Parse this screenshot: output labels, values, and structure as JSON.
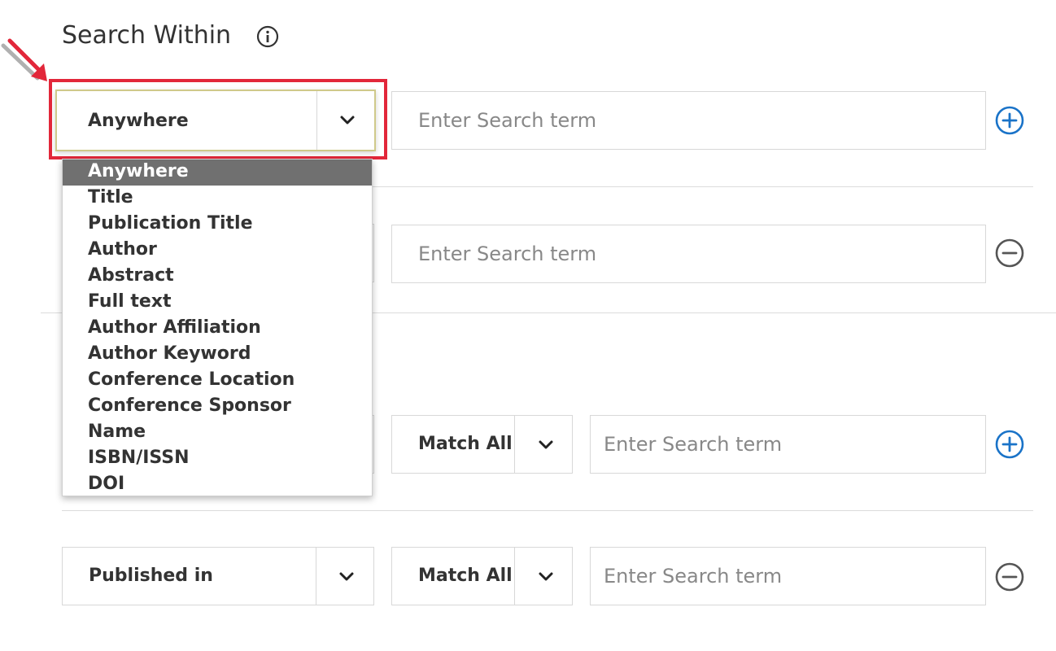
{
  "search_within": {
    "heading": "Search Within",
    "info_icon": "info-circle-icon"
  },
  "rows": [
    {
      "field": "Anywhere",
      "placeholder": "Enter Search term",
      "action": "add"
    },
    {
      "field": "",
      "placeholder": "Enter Search term",
      "action": "remove"
    },
    {
      "field": "",
      "match": "Match All",
      "placeholder": "Enter Search term",
      "action": "add"
    },
    {
      "field": "Published in",
      "match": "Match All",
      "placeholder": "Enter Search term",
      "action": "remove"
    }
  ],
  "dropdown": {
    "selected": "Anywhere",
    "options": [
      "Anywhere",
      "Title",
      "Publication Title",
      "Author",
      "Abstract",
      "Full text",
      "Author Affiliation",
      "Author Keyword",
      "Conference Location",
      "Conference Sponsor",
      "Name",
      "ISBN/ISSN",
      "DOI"
    ]
  },
  "colors": {
    "accent_blue": "#1a73c8",
    "highlight_red": "#e2273a",
    "selected_option_bg": "#707070",
    "remove_icon": "#555555"
  },
  "icons": {
    "add": "plus-circle-icon",
    "remove": "minus-circle-icon",
    "chevron": "chevron-down-icon"
  }
}
